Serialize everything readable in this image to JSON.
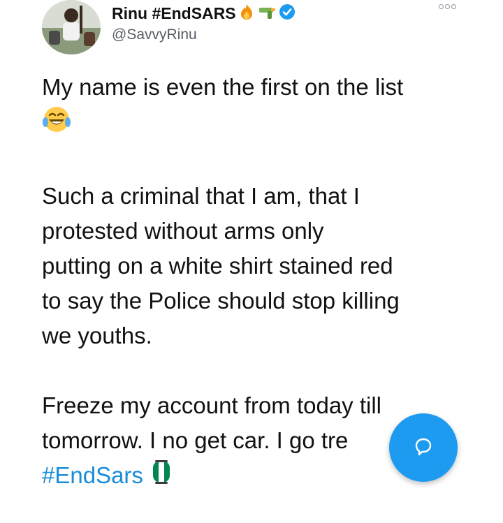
{
  "author": {
    "display_name": "Rinu #EndSARS",
    "handle": "@SavvyRinu",
    "verified": true,
    "name_emojis": [
      "fire-emoji",
      "water-pistol-emoji"
    ]
  },
  "tweet": {
    "paragraph_1": "My name is even the first on the list",
    "paragraph_1_emoji": "face-with-tears-of-joy-emoji",
    "paragraph_2_lines": [
      "Such a criminal that I am, that I",
      "protested without arms only",
      "putting on a white shirt stained red",
      "to say the Police should stop killing",
      "we youths."
    ],
    "paragraph_3_lines": [
      "Freeze my account from today till",
      "tomorrow. I no get car. I go tre"
    ],
    "hashtag": "#EndSars",
    "hashtag_emoji": "nigeria-flag-emoji"
  },
  "controls": {
    "more_icon": "more-options-icon",
    "fab_icon": "reply-compose-icon"
  },
  "colors": {
    "link_blue": "#1a8cd8",
    "fab_blue": "#1d9bf0",
    "verified_blue": "#1d9bf0",
    "handle_gray": "#555d66"
  }
}
